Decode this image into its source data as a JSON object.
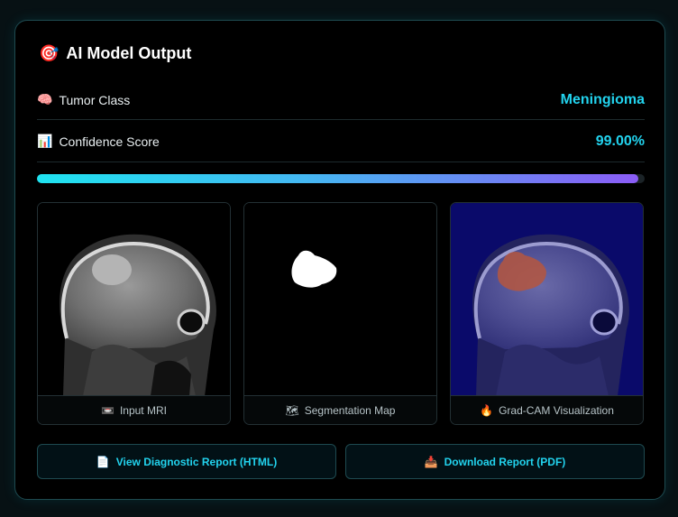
{
  "header": {
    "icon": "target-icon",
    "icon_glyph": "🎯",
    "title": "AI Model Output"
  },
  "tumor": {
    "icon": "brain-icon",
    "icon_glyph": "🧠",
    "label": "Tumor Class",
    "value": "Meningioma"
  },
  "confidence": {
    "icon": "bar-chart-icon",
    "icon_glyph": "📊",
    "label": "Confidence Score",
    "value": "99.00%",
    "fraction": 0.99
  },
  "panels": [
    {
      "icon": "monitor-icon",
      "icon_glyph": "📼",
      "caption": "Input MRI"
    },
    {
      "icon": "map-icon",
      "icon_glyph": "🗺",
      "caption": "Segmentation Map"
    },
    {
      "icon": "flame-icon",
      "icon_glyph": "🔥",
      "caption": "Grad-CAM Visualization"
    }
  ],
  "buttons": {
    "view": {
      "icon": "document-icon",
      "icon_glyph": "📄",
      "label": "View Diagnostic Report (HTML)"
    },
    "download": {
      "icon": "download-icon",
      "icon_glyph": "📥",
      "label": "Download Report (PDF)"
    }
  },
  "colors": {
    "accent": "#22d3ee",
    "gradient_start": "#1fe3f0",
    "gradient_end": "#8b5cf6",
    "border": "#1e4a50"
  }
}
